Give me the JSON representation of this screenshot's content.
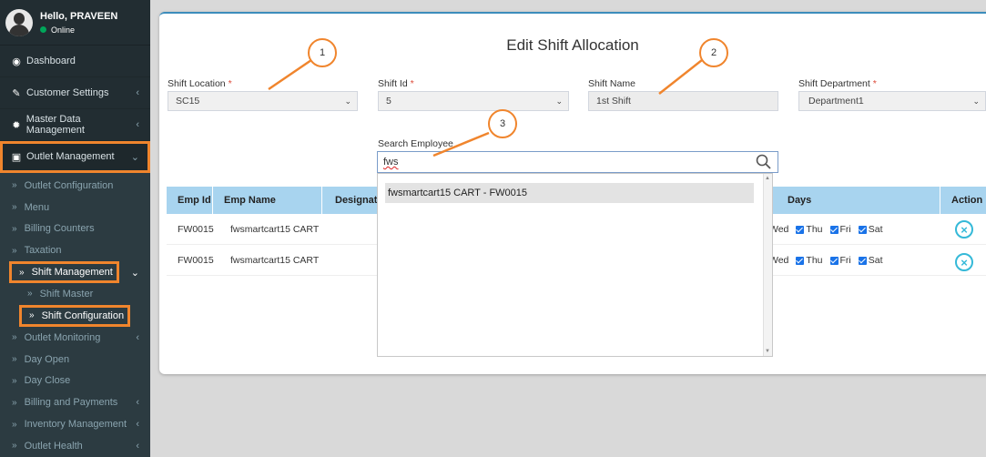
{
  "user": {
    "greeting": "Hello, PRAVEEN",
    "status": "Online"
  },
  "sidebar": {
    "items": [
      {
        "label": "Dashboard",
        "icon": "dashboard-icon"
      },
      {
        "label": "Customer Settings",
        "icon": "wrench-icon"
      },
      {
        "label": "Master Data Management",
        "icon": "gear-icon"
      },
      {
        "label": "Outlet Management",
        "icon": "store-icon"
      }
    ],
    "outlet_sub": [
      {
        "label": "Outlet Configuration"
      },
      {
        "label": "Menu"
      },
      {
        "label": "Billing Counters"
      },
      {
        "label": "Taxation"
      },
      {
        "label": "Shift Management"
      },
      {
        "label": "Outlet Monitoring"
      },
      {
        "label": "Day Open"
      },
      {
        "label": "Day Close"
      },
      {
        "label": "Billing and Payments"
      },
      {
        "label": "Inventory Management"
      },
      {
        "label": "Outlet Health"
      }
    ],
    "shift_sub": [
      {
        "label": "Shift Master"
      },
      {
        "label": "Shift Configuration"
      }
    ]
  },
  "form": {
    "title": "Edit Shift Allocation",
    "shift_location": {
      "label": "Shift Location",
      "value": "SC15"
    },
    "shift_id": {
      "label": "Shift Id",
      "value": "5"
    },
    "shift_name": {
      "label": "Shift Name",
      "value": "1st Shift"
    },
    "shift_department": {
      "label": "Shift Department",
      "value": "Department1"
    },
    "required_mark": "*",
    "search": {
      "label": "Search Employee",
      "value": "fws"
    }
  },
  "dropdown": {
    "option": "fwsmartcart15 CART - FW0015"
  },
  "table": {
    "headers": {
      "emp_id": "Emp Id",
      "emp_name": "Emp Name",
      "designation": "Designatio",
      "days": "Days",
      "action": "Action"
    },
    "rows": [
      {
        "emp_id": "FW0015",
        "emp_name": "fwsmartcart15 CART",
        "days": [
          "Wed",
          "Thu",
          "Fri",
          "Sat"
        ]
      },
      {
        "emp_id": "FW0015",
        "emp_name": "fwsmartcart15 CART",
        "days": [
          "Wed",
          "Thu",
          "Fri",
          "Sat"
        ]
      }
    ]
  },
  "callouts": [
    "1",
    "2",
    "3"
  ],
  "colors": {
    "highlight": "#f0852d",
    "sidebar_bg": "#222d32",
    "table_header": "#a8d4ef",
    "accent": "#3c8dbc"
  }
}
